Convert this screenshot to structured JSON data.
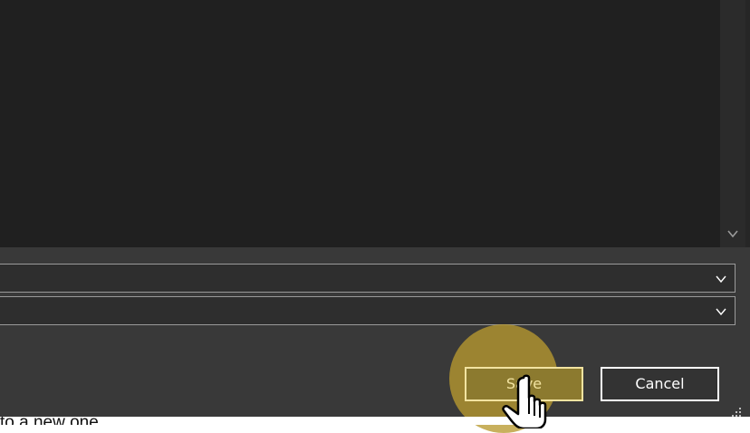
{
  "dialog": {
    "list": {
      "empty": true
    },
    "fields": [
      {
        "value": "",
        "kind": "dropdown"
      },
      {
        "value": "",
        "kind": "dropdown"
      }
    ],
    "buttons": {
      "save_label": "Save",
      "cancel_label": "Cancel"
    },
    "focused_button": "save"
  },
  "background": {
    "partial_text": "to a new one"
  },
  "icons": {
    "scroll_down": "chevron-down-icon",
    "dropdown": "chevron-down-icon",
    "resize": "resize-grip-icon",
    "pointer": "hand-pointer-icon"
  },
  "colors": {
    "dialog_bg": "#393939",
    "list_bg": "#202020",
    "highlight": "#b89a30",
    "button_border": "#ffffff"
  }
}
